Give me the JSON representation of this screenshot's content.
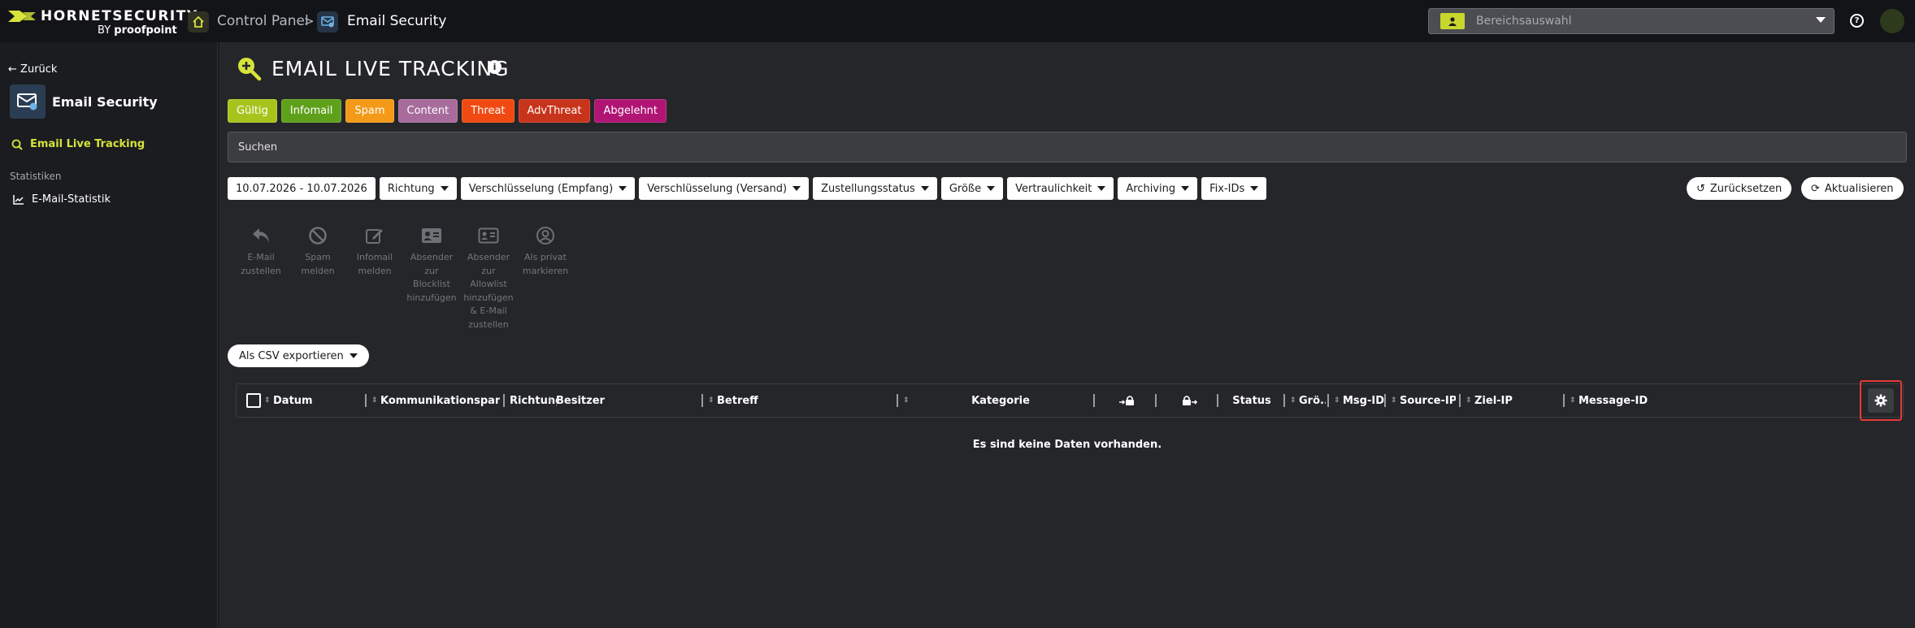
{
  "brand": {
    "name": "HORNETSECURITY",
    "by": "BY",
    "sub": "proofpoint",
    "color": "#d7e33a"
  },
  "breadcrumb": {
    "home": "Control Panel",
    "separator": ">",
    "current": "Email Security"
  },
  "area_select": {
    "placeholder": "Bereichsauswahl"
  },
  "header_icons": [
    "house-icon",
    "email-security-icon",
    "user-icon",
    "chevron-down-icon",
    "help-icon",
    "avatar"
  ],
  "sidebar": {
    "back": "Zurück",
    "module_title": "Email Security",
    "active_item": "Email Live Tracking",
    "section": "Statistiken",
    "stats_item": "E-Mail-Statistik"
  },
  "page": {
    "title": "EMAIL LIVE TRACKING",
    "info": "i"
  },
  "categories": [
    {
      "label": "Gültig",
      "color": "#a7c41d"
    },
    {
      "label": "Infomail",
      "color": "#5fa01b"
    },
    {
      "label": "Spam",
      "color": "#f39a18"
    },
    {
      "label": "Content",
      "color": "#a76b9c"
    },
    {
      "label": "Threat",
      "color": "#f04a12"
    },
    {
      "label": "AdvThreat",
      "color": "#c8341b"
    },
    {
      "label": "Abgelehnt",
      "color": "#b01574"
    }
  ],
  "search": {
    "placeholder": "Suchen"
  },
  "filters": [
    {
      "label": "10.07.2026 - 10.07.2026",
      "dropdown": false
    },
    {
      "label": "Richtung",
      "dropdown": true
    },
    {
      "label": "Verschlüsselung (Empfang)",
      "dropdown": true
    },
    {
      "label": "Verschlüsselung (Versand)",
      "dropdown": true
    },
    {
      "label": "Zustellungsstatus",
      "dropdown": true
    },
    {
      "label": "Größe",
      "dropdown": true
    },
    {
      "label": "Vertraulichkeit",
      "dropdown": true
    },
    {
      "label": "Archiving",
      "dropdown": true
    },
    {
      "label": "Fix-IDs",
      "dropdown": true
    }
  ],
  "buttons": {
    "reset": "Zurücksetzen",
    "refresh": "Aktualisieren",
    "csv": "Als CSV exportieren"
  },
  "actions": [
    {
      "label_lines": [
        "E-Mail",
        "zustellen"
      ],
      "icon": "reply-icon"
    },
    {
      "label_lines": [
        "Spam",
        "melden"
      ],
      "icon": "ban-icon"
    },
    {
      "label_lines": [
        "Infomail",
        "melden"
      ],
      "icon": "edit-icon"
    },
    {
      "label_lines": [
        "Absender",
        "zur",
        "Blocklist",
        "hinzufügen"
      ],
      "icon": "id-card-icon"
    },
    {
      "label_lines": [
        "Absender",
        "zur",
        "Allowlist",
        "hinzufügen",
        "& E-Mail",
        "zustellen"
      ],
      "icon": "id-card-outline-icon"
    },
    {
      "label_lines": [
        "Als privat",
        "markieren"
      ],
      "icon": "user-circle-icon"
    }
  ],
  "table": {
    "columns": [
      "Datum",
      "Kommunikationspartner",
      "Richtung",
      "Besitzer",
      "Betreff",
      "",
      "Kategorie",
      "",
      "",
      "Status",
      "Grö...",
      "Msg-ID",
      "Source-IP",
      "Ziel-IP",
      "Message-ID"
    ],
    "empty_text": "Es sind keine Daten vorhanden."
  }
}
